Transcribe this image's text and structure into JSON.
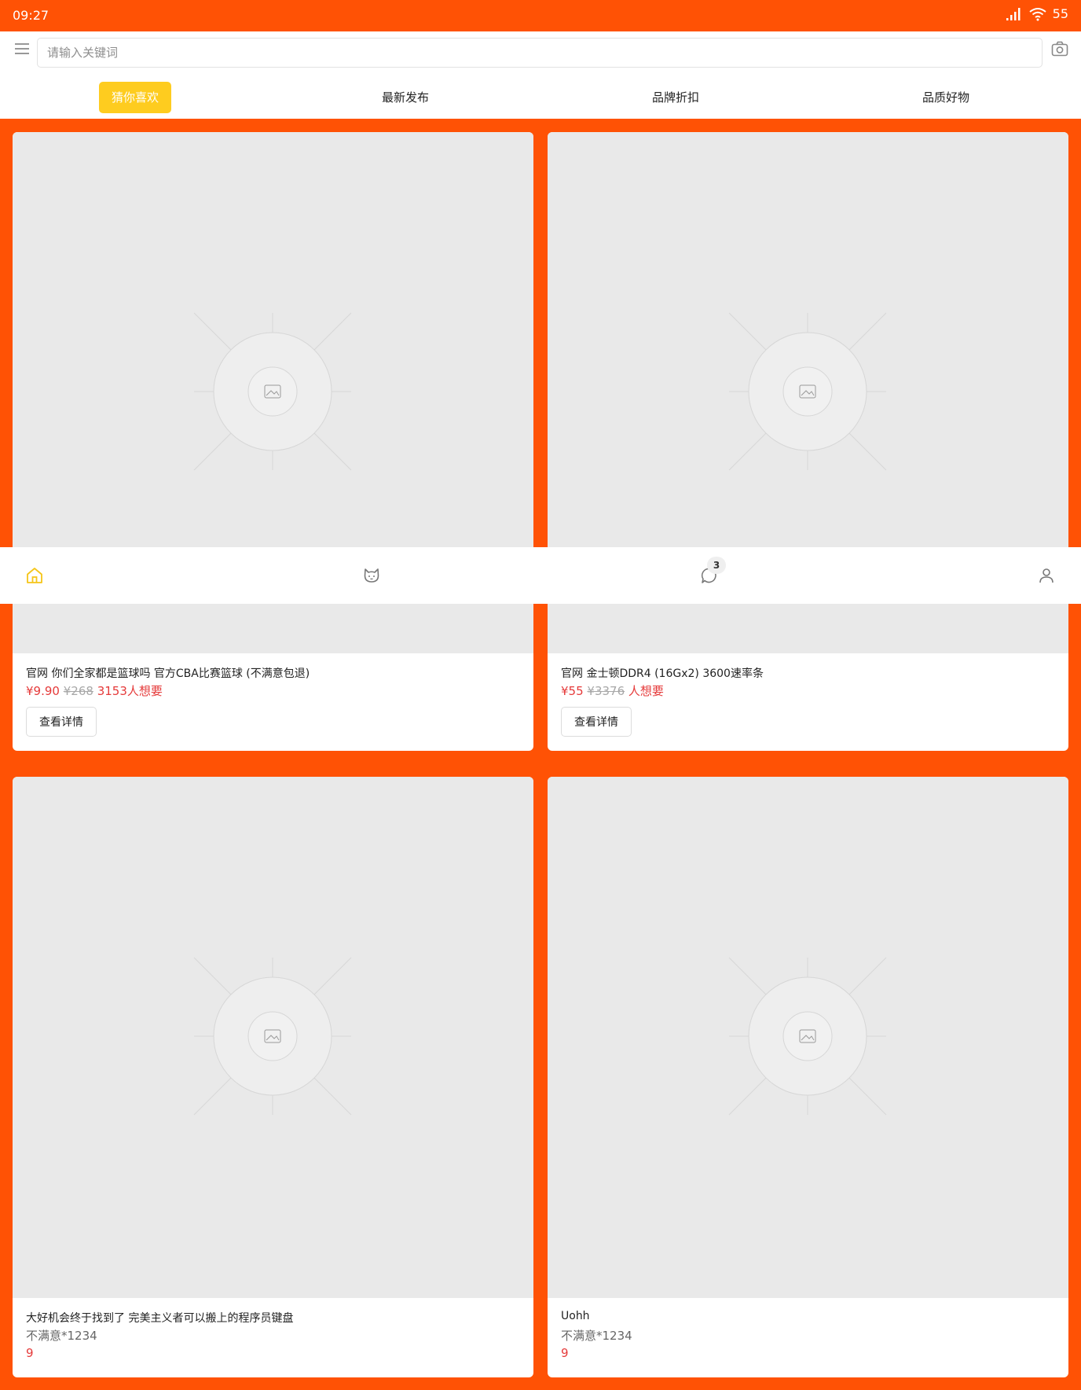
{
  "status_bar": {
    "time": "09:27",
    "battery": "55"
  },
  "search": {
    "placeholder": "请输入关键词"
  },
  "tabs": [
    {
      "label": "猜你喜欢",
      "active": true
    },
    {
      "label": "最新发布",
      "active": false
    },
    {
      "label": "品牌折扣",
      "active": false
    },
    {
      "label": "品质好物",
      "active": false
    }
  ],
  "products": [
    {
      "title": "官网 你们全家都是篮球吗 官方CBA比赛篮球 (不满意包退)",
      "price": "¥9.90",
      "original_price": "¥268",
      "wants": "3153人想要",
      "button": "查看详情"
    },
    {
      "title": "官网 金士顿DDR4 (16Gx2) 3600速率条",
      "price": "¥55",
      "original_price": "¥3376",
      "wants": "人想要",
      "button": "查看详情"
    },
    {
      "title": "大好机会终于找到了 完美主义者可以搬上的程序员键盘",
      "subtitle": "不满意*1234",
      "value": "9"
    },
    {
      "title": "Uohh",
      "subtitle": "不满意*1234",
      "value": "9"
    }
  ],
  "bottom_nav": {
    "message_badge": "3",
    "items": [
      "home-icon",
      "cat-icon",
      "message-icon",
      "user-icon"
    ]
  },
  "colors": {
    "brand": "#FF5205",
    "tab_active": "#FECC1F",
    "price": "#E53A3A",
    "placeholder_bg": "#E9E9E9"
  }
}
